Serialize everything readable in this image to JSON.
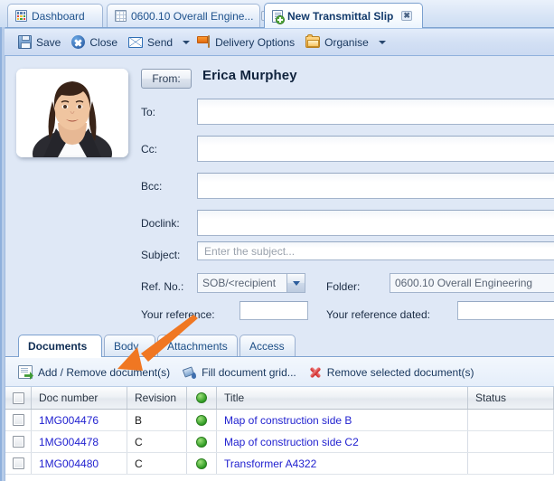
{
  "window": {
    "tabs": [
      {
        "label": "Dashboard",
        "icon": "dashboard-icon",
        "closable": false,
        "active": false
      },
      {
        "label": "0600.10 Overall Engine...",
        "icon": "spreadsheet-icon",
        "closable": true,
        "active": false
      },
      {
        "label": "New Transmittal Slip",
        "icon": "new-document-icon",
        "closable": true,
        "active": true
      }
    ],
    "close_glyph": "✖"
  },
  "toolbar": {
    "save_label": "Save",
    "close_label": "Close",
    "send_label": "Send",
    "delivery_options_label": "Delivery Options",
    "organise_label": "Organise"
  },
  "form": {
    "from_button_label": "From:",
    "from_name": "Erica Murphey",
    "to_label": "To:",
    "to_value": "",
    "cc_label": "Cc:",
    "cc_value": "",
    "bcc_label": "Bcc:",
    "bcc_value": "",
    "doclink_label": "Doclink:",
    "doclink_value": "",
    "subject_label": "Subject:",
    "subject_placeholder": "Enter the subject...",
    "subject_value": "",
    "ref_no_label": "Ref. No.:",
    "ref_no_value": "SOB/<recipient",
    "folder_label": "Folder:",
    "folder_value": "0600.10 Overall Engineering",
    "your_reference_label": "Your reference:",
    "your_reference_value": "",
    "your_reference_dated_label": "Your reference dated:",
    "your_reference_dated_value": ""
  },
  "subtabs": [
    {
      "label": "Documents",
      "active": true
    },
    {
      "label": "Body",
      "active": false
    },
    {
      "label": "Attachments",
      "active": false
    },
    {
      "label": "Access",
      "active": false
    }
  ],
  "doc_toolbar": {
    "add_remove_label": "Add / Remove document(s)",
    "fill_grid_label": "Fill document grid...",
    "remove_selected_label": "Remove selected document(s)"
  },
  "grid": {
    "columns": [
      "",
      "Doc number",
      "Revision",
      "",
      "Title",
      "Status"
    ],
    "rows": [
      {
        "doc_number": "1MG004476",
        "revision": "B",
        "status_dot": "green",
        "title": "Map of construction side B",
        "status": ""
      },
      {
        "doc_number": "1MG004478",
        "revision": "C",
        "status_dot": "green",
        "title": "Map of construction side C2",
        "status": ""
      },
      {
        "doc_number": "1MG004480",
        "revision": "C",
        "status_dot": "green",
        "title": "Transformer A4322",
        "status": ""
      }
    ]
  },
  "colors": {
    "background": "#dfe8f6",
    "accent": "#2f6fb5",
    "link": "#2222d0",
    "annotation_arrow": "#f07722",
    "status_green": "#2f9c24"
  }
}
